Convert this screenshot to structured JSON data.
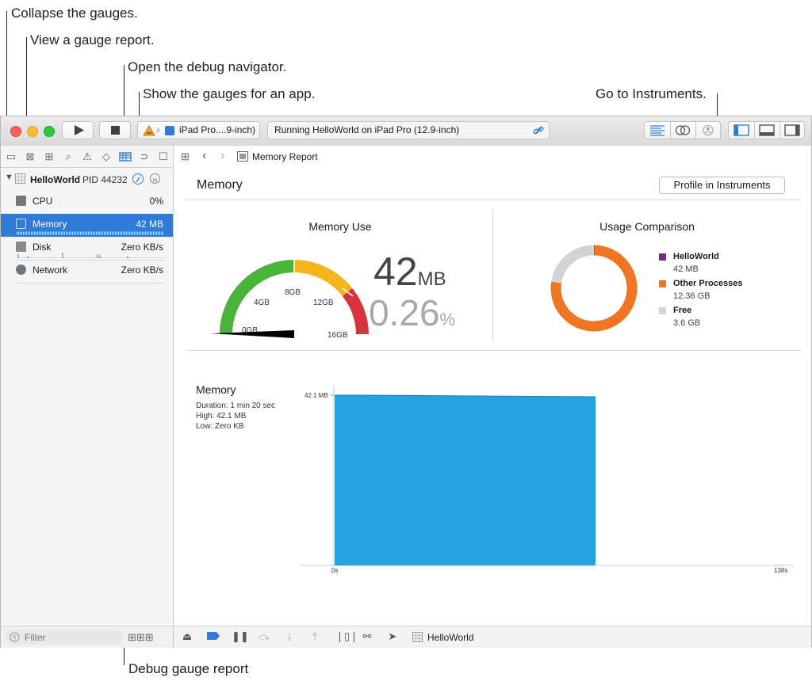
{
  "callouts": {
    "collapse": "Collapse the gauges.",
    "view_report": "View a gauge report.",
    "debug_navigator": "Open the debug navigator.",
    "show_gauges": "Show the gauges for an app.",
    "instruments": "Go to Instruments.",
    "gauge_report": "Debug gauge report"
  },
  "toolbar": {
    "scheme_device": "iPad Pro....9-inch)",
    "activity": "Running HelloWorld on iPad Pro (12.9-inch)"
  },
  "navigator": {
    "process_name": "HelloWorld",
    "process_pid": "PID 44232",
    "gauges": [
      {
        "label": "CPU",
        "value": "0%"
      },
      {
        "label": "Memory",
        "value": "42 MB"
      },
      {
        "label": "Disk",
        "value": "Zero KB/s"
      },
      {
        "label": "Network",
        "value": "Zero KB/s"
      }
    ],
    "filter_placeholder": "Filter"
  },
  "jumpbar": {
    "breadcrumb": "Memory Report"
  },
  "report": {
    "title": "Memory",
    "profile_button": "Profile in Instruments",
    "memory_use": {
      "heading": "Memory Use",
      "value": "42",
      "unit": "MB",
      "percent": "0.26",
      "percent_unit": "%",
      "ticks": [
        "0GB",
        "4GB",
        "8GB",
        "12GB",
        "16GB"
      ],
      "needle_gb": 0.04
    },
    "usage": {
      "heading": "Usage Comparison",
      "legend": [
        {
          "name": "HelloWorld",
          "value": "42 MB",
          "color": "#7a2a86",
          "gb": 0.042
        },
        {
          "name": "Other Processes",
          "value": "12.36 GB",
          "color": "#f07522",
          "gb": 12.36
        },
        {
          "name": "Free",
          "value": "3.6 GB",
          "color": "#d3d3d3",
          "gb": 3.6
        }
      ]
    },
    "timeline": {
      "heading": "Memory",
      "duration": "Duration: 1 min 20 sec",
      "high": "High: 42.1 MB",
      "low": "Low: Zero KB",
      "y_label": "42.1 MB",
      "x_start": "0s",
      "x_end": "138s",
      "fill_color": "#26a2e0"
    }
  },
  "debugbar": {
    "process": "HelloWorld"
  }
}
